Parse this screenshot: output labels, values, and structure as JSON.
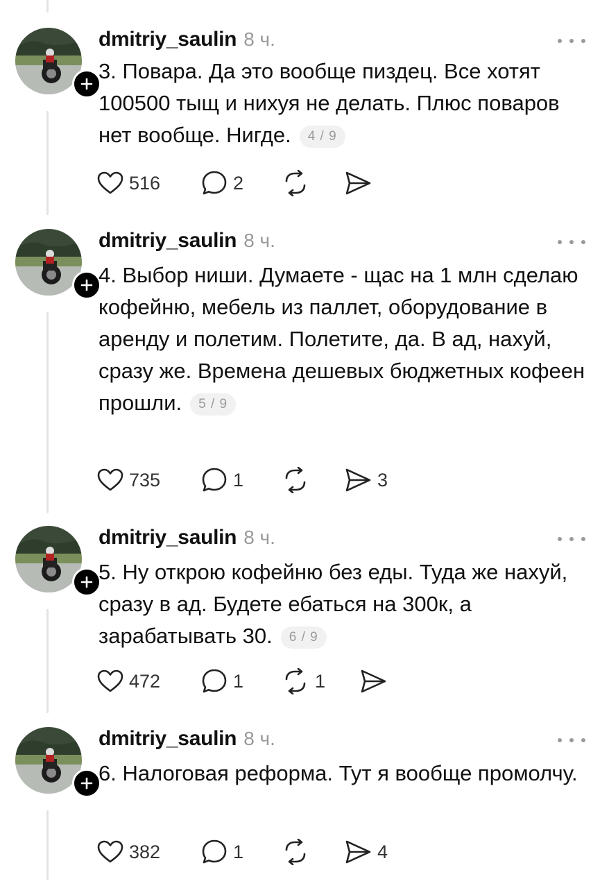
{
  "posts": [
    {
      "username": "dmitriy_saulin",
      "time": "8 ч.",
      "text": "3. Повара. Да это вообще пиздец. Все хотят 100500 тыщ и нихуя не делать. Плюс поваров нет вообще. Нигде.",
      "counter": "4/9",
      "likes": "516",
      "comments": "2",
      "reposts": "",
      "shares": ""
    },
    {
      "username": "dmitriy_saulin",
      "time": "8 ч.",
      "text": "4. Выбор ниши. Думаете - щас на 1 млн сделаю кофейню, мебель из паллет, оборудование в аренду и полетим. Полетите, да. В ад, нахуй, сразу же. Времена дешевых бюджетных кофеен прошли.",
      "counter": "5/9",
      "likes": "735",
      "comments": "1",
      "reposts": "",
      "shares": "3"
    },
    {
      "username": "dmitriy_saulin",
      "time": "8 ч.",
      "text": "5. Ну открою кофейню без еды. Туда же нахуй, сразу в ад. Будете ебаться на 300к, а зарабатывать 30.",
      "counter": "6/9",
      "likes": "472",
      "comments": "1",
      "reposts": "1",
      "shares": ""
    },
    {
      "username": "dmitriy_saulin",
      "time": "8 ч.",
      "text": "6. Налоговая реформа. Тут я вообще промолчу.",
      "counter": "",
      "likes": "382",
      "comments": "1",
      "reposts": "",
      "shares": "4"
    }
  ],
  "icons": {
    "like": "heart-icon",
    "comment": "speech-bubble-icon",
    "repost": "repost-arrows-icon",
    "share": "paper-plane-icon",
    "follow": "plus-icon",
    "more": "more-dots-icon"
  },
  "colors": {
    "text": "#111111",
    "muted": "#9a9a9a",
    "thread_line": "#e3e3e3",
    "badge": "#000000"
  }
}
